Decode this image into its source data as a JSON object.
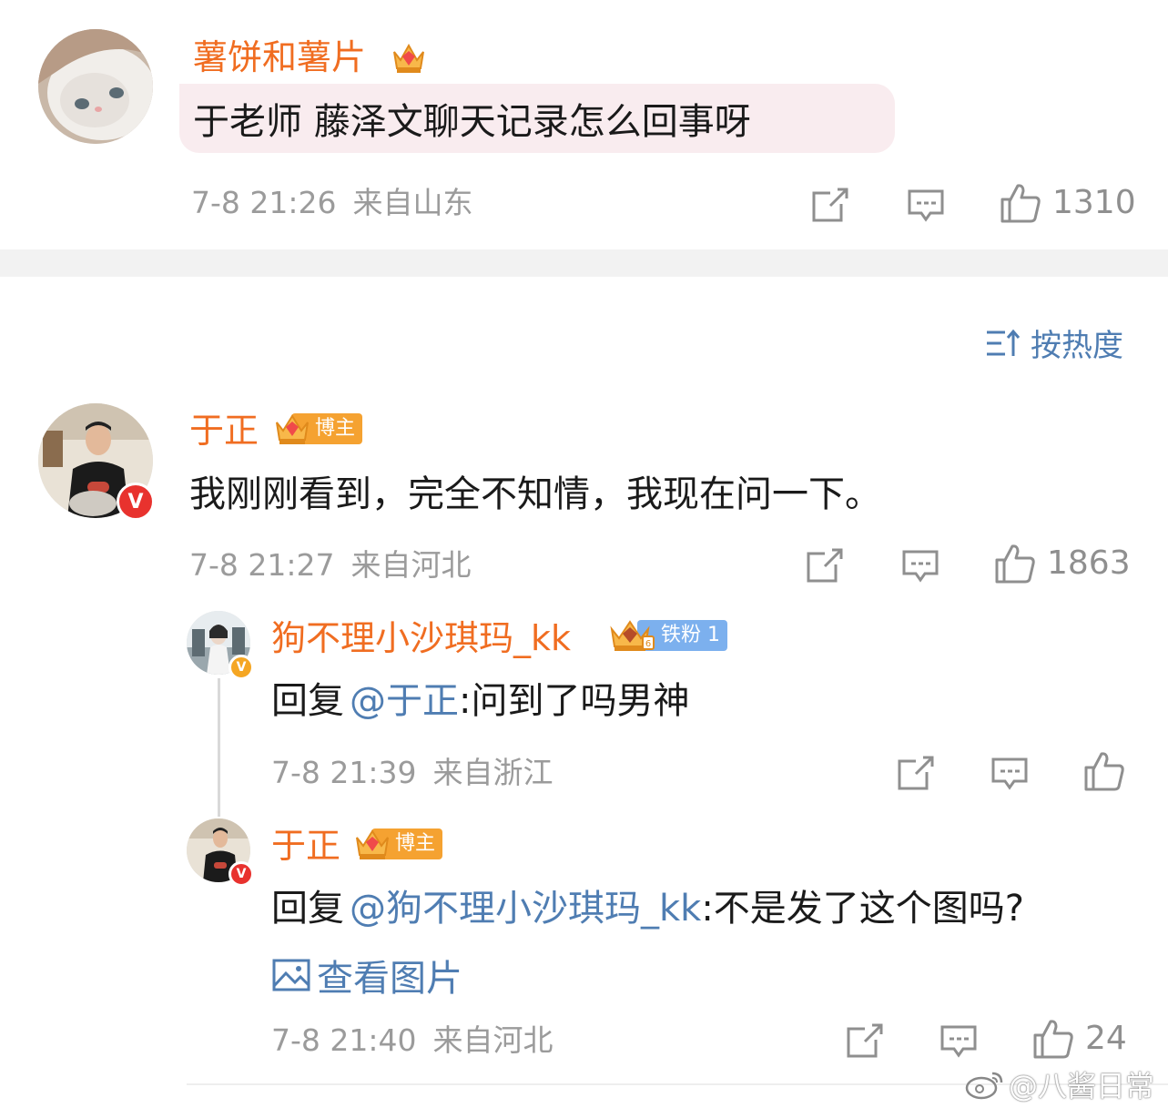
{
  "comments": [
    {
      "username": "薯饼和薯片",
      "content": "于老师 藤泽文聊天记录怎么回事呀",
      "time": "7-8 21:26",
      "location": "来自山东",
      "likes": "1310"
    }
  ],
  "sort": {
    "label": "按热度"
  },
  "post": {
    "username": "于正",
    "tag": "博主",
    "content": "我刚刚看到，完全不知情，我现在问一下。",
    "time": "7-8 21:27",
    "location": "来自河北",
    "likes": "1863"
  },
  "replies": [
    {
      "username": "狗不理小沙琪玛_kk",
      "tag": "铁粉",
      "tag_level": "1",
      "reply_prefix": "回复",
      "mention": "@于正",
      "text": ":问到了吗男神",
      "time": "7-8 21:39",
      "location": "来自浙江"
    },
    {
      "username": "于正",
      "tag": "博主",
      "reply_prefix": "回复",
      "mention": "@狗不理小沙琪玛_kk",
      "text": ":不是发了这个图吗?",
      "image_link": "查看图片",
      "time": "7-8 21:40",
      "location": "来自河北",
      "likes": "24"
    }
  ],
  "watermark": "@八酱日常",
  "colors": {
    "username": "#f06d21",
    "link": "#4f7db2",
    "meta": "#9b9b9b",
    "verified": "#e8322e",
    "fan_tag": "#7cb0ee",
    "blogger_tag": "#f5a231"
  }
}
